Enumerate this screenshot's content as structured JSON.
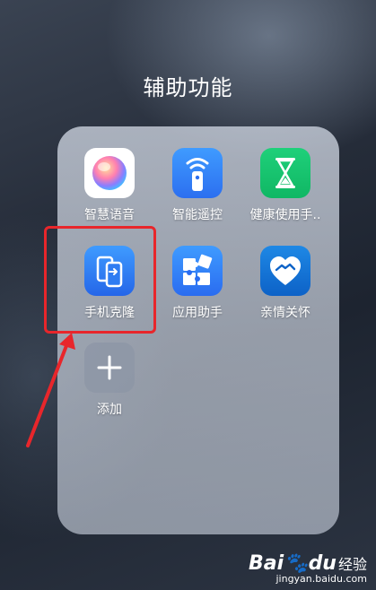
{
  "folder": {
    "title": "辅助功能",
    "apps": [
      {
        "label": "智慧语音",
        "icon": "voice-assistant-icon"
      },
      {
        "label": "智能遥控",
        "icon": "remote-control-icon"
      },
      {
        "label": "健康使用手..",
        "icon": "hourglass-icon"
      },
      {
        "label": "手机克隆",
        "icon": "phone-clone-icon"
      },
      {
        "label": "应用助手",
        "icon": "puzzle-icon"
      },
      {
        "label": "亲情关怀",
        "icon": "heart-hands-icon"
      }
    ],
    "add": {
      "label": "添加",
      "icon": "plus-icon"
    }
  },
  "annotation": {
    "highlight_color": "#e8262b"
  },
  "watermark": {
    "brand": "Bai",
    "paw": "du",
    "cn": "经验",
    "url": "jingyan.baidu.com"
  }
}
